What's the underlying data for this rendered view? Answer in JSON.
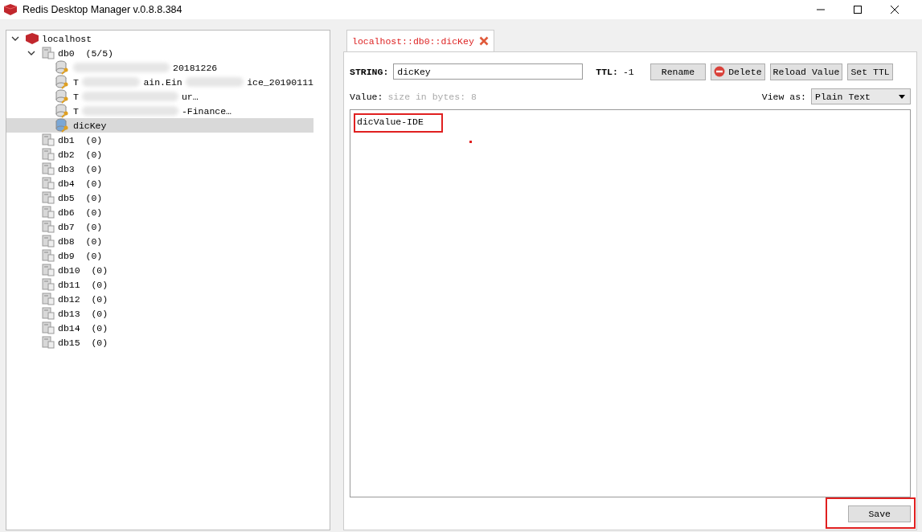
{
  "window": {
    "title": "Redis Desktop Manager v.0.8.8.384"
  },
  "tree": {
    "label": "localhost",
    "expanded": true,
    "children": [
      {
        "label": "db0",
        "count": "(5/5)",
        "expanded": true,
        "keys": [
          {
            "fragments": [
              "20181226"
            ],
            "selected": false
          },
          {
            "fragments": [
              "T",
              "ain.Ein",
              "ice_20190111"
            ],
            "selected": false
          },
          {
            "fragments": [
              "T",
              "ur…"
            ],
            "selected": false
          },
          {
            "fragments": [
              "T",
              "-Finance…"
            ],
            "selected": false
          },
          {
            "fragments": [
              "dicKey"
            ],
            "selected": true
          }
        ]
      },
      {
        "label": "db1",
        "count": "(0)",
        "expanded": false
      },
      {
        "label": "db2",
        "count": "(0)",
        "expanded": false
      },
      {
        "label": "db3",
        "count": "(0)",
        "expanded": false
      },
      {
        "label": "db4",
        "count": "(0)",
        "expanded": false
      },
      {
        "label": "db5",
        "count": "(0)",
        "expanded": false
      },
      {
        "label": "db6",
        "count": "(0)",
        "expanded": false
      },
      {
        "label": "db7",
        "count": "(0)",
        "expanded": false
      },
      {
        "label": "db8",
        "count": "(0)",
        "expanded": false
      },
      {
        "label": "db9",
        "count": "(0)",
        "expanded": false
      },
      {
        "label": "db10",
        "count": "(0)",
        "expanded": false
      },
      {
        "label": "db11",
        "count": "(0)",
        "expanded": false
      },
      {
        "label": "db12",
        "count": "(0)",
        "expanded": false
      },
      {
        "label": "db13",
        "count": "(0)",
        "expanded": false
      },
      {
        "label": "db14",
        "count": "(0)",
        "expanded": false
      },
      {
        "label": "db15",
        "count": "(0)",
        "expanded": false
      }
    ]
  },
  "tabs": [
    {
      "label": "localhost::db0::dicKey",
      "selected": true
    }
  ],
  "editor": {
    "type_label": "STRING:",
    "key_value": "dicKey",
    "ttl_label": "TTL:",
    "ttl": "-1",
    "buttons": [
      {
        "label": "Rename",
        "kind": "plain"
      },
      {
        "label": "Delete",
        "kind": "delete"
      },
      {
        "label": "Reload Value",
        "kind": "plain"
      },
      {
        "label": "Set TTL",
        "kind": "plain"
      }
    ],
    "value_label": "Value:",
    "size_hint": "size in bytes: 8",
    "view_as_label": "View as:",
    "view_as": "Plain Text",
    "value": "dicValue-IDE",
    "value_annotated": true,
    "save_label": "Save",
    "save_annotated": true
  }
}
